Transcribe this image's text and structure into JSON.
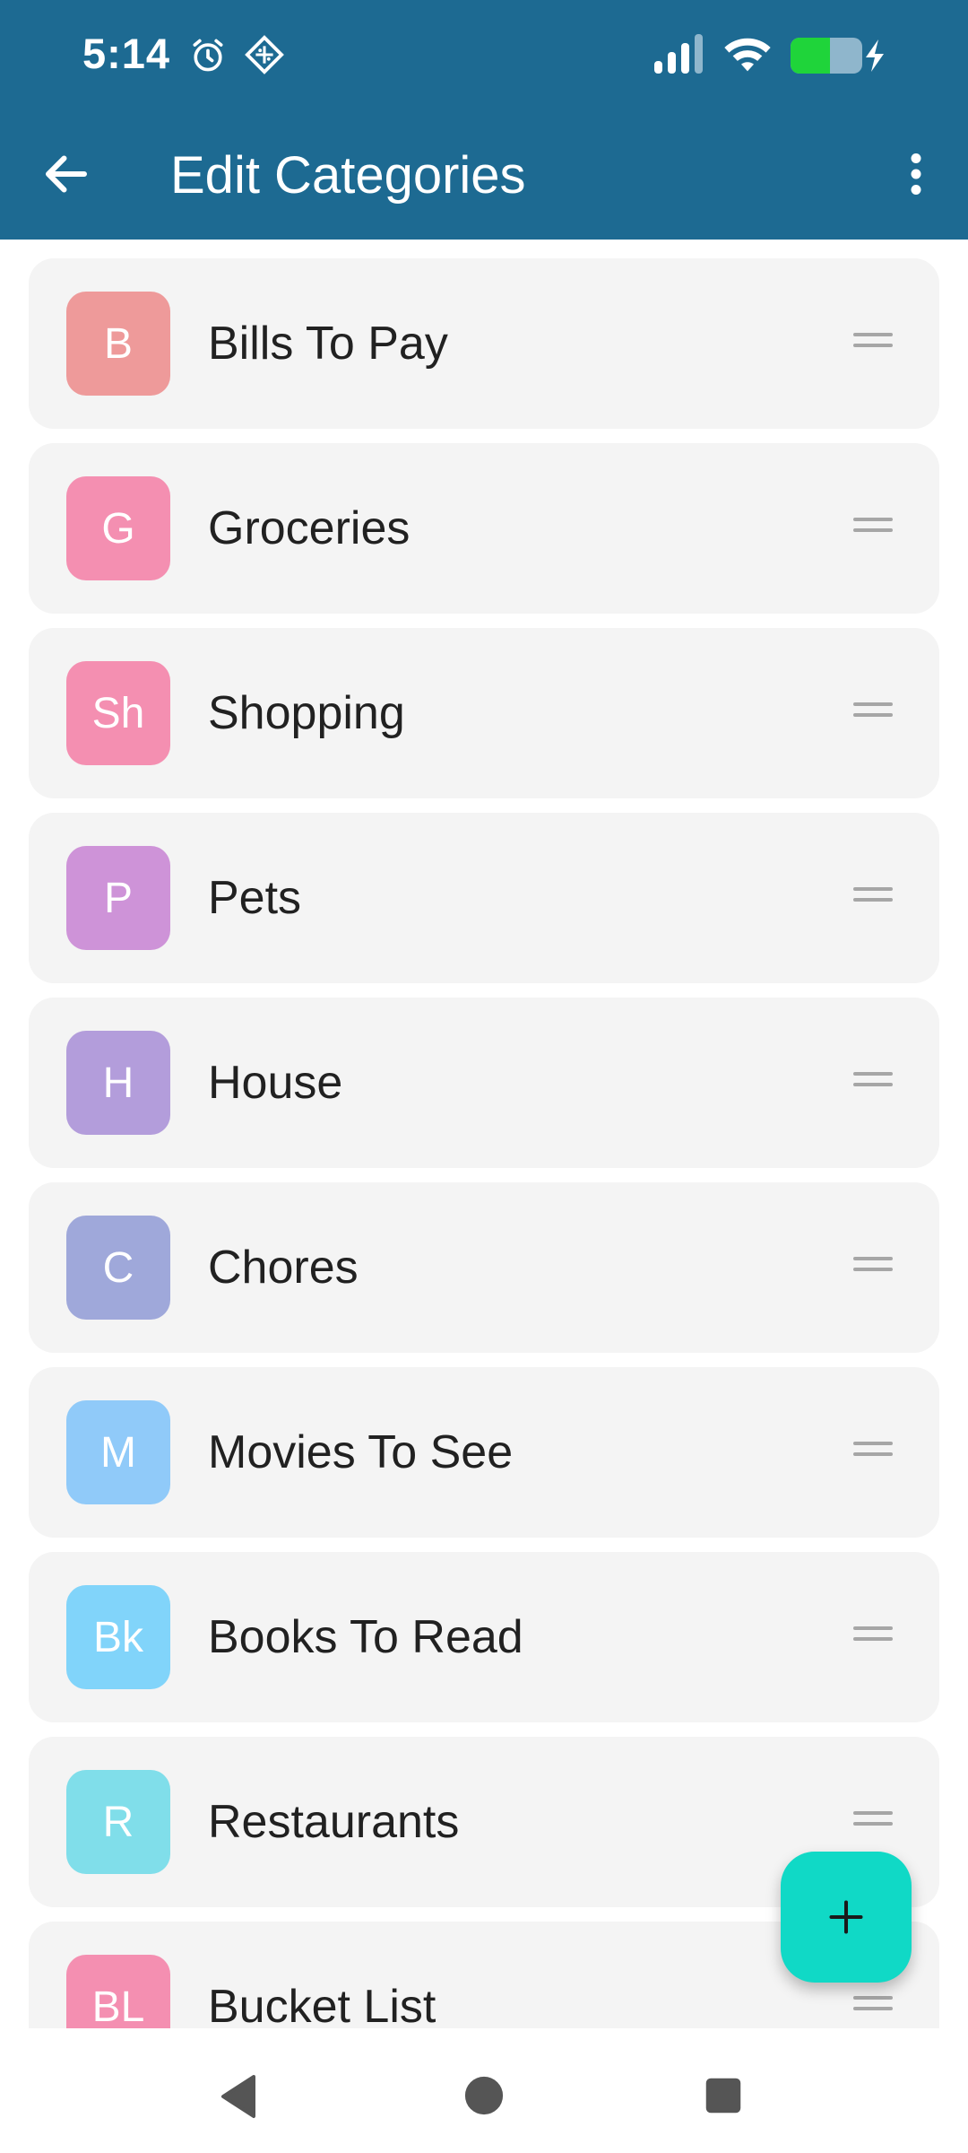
{
  "status_bar": {
    "time": "5:14",
    "icons": [
      "alarm-icon",
      "app-notification-icon",
      "signal-icon",
      "wifi-icon",
      "battery-charging-icon"
    ]
  },
  "toolbar": {
    "title": "Edit Categories",
    "back_icon": "arrow-left-icon",
    "menu_icon": "more-vert-icon"
  },
  "categories": [
    {
      "initials": "B",
      "name": "Bills To Pay",
      "color": "#ee9a9a"
    },
    {
      "initials": "G",
      "name": "Groceries",
      "color": "#f48fb1"
    },
    {
      "initials": "Sh",
      "name": "Shopping",
      "color": "#f48fb1"
    },
    {
      "initials": "P",
      "name": "Pets",
      "color": "#ce93d8"
    },
    {
      "initials": "H",
      "name": "House",
      "color": "#b39ddb"
    },
    {
      "initials": "C",
      "name": "Chores",
      "color": "#9fa8da"
    },
    {
      "initials": "M",
      "name": "Movies To See",
      "color": "#90caf9"
    },
    {
      "initials": "Bk",
      "name": "Books To Read",
      "color": "#81d4fa"
    },
    {
      "initials": "R",
      "name": "Restaurants",
      "color": "#80deea"
    },
    {
      "initials": "BL",
      "name": "Bucket List",
      "color": "#f48fb1"
    }
  ],
  "fab": {
    "icon": "plus-icon",
    "color": "#10d9c6"
  },
  "nav": {
    "icons": [
      "back-triangle-icon",
      "home-circle-icon",
      "recents-square-icon"
    ]
  },
  "colors": {
    "appbar": "#1d6a92",
    "card": "#f4f4f4"
  }
}
